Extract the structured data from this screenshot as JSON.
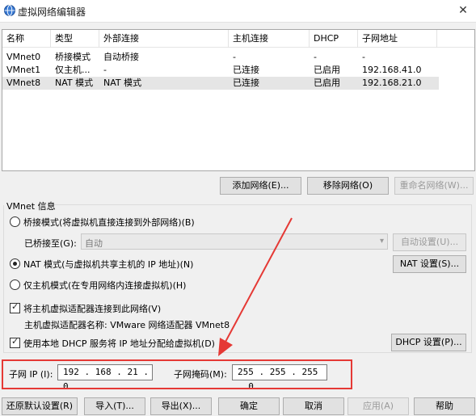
{
  "window": {
    "title": "虚拟网络编辑器",
    "close_glyph": "✕"
  },
  "table": {
    "headers": [
      "名称",
      "类型",
      "外部连接",
      "主机连接",
      "DHCP",
      "子网地址"
    ],
    "rows": [
      [
        "VMnet0",
        "桥接模式",
        "自动桥接",
        "-",
        "-",
        "-"
      ],
      [
        "VMnet1",
        "仅主机...",
        "-",
        "已连接",
        "已启用",
        "192.168.41.0"
      ],
      [
        "VMnet8",
        "NAT 模式",
        "NAT 模式",
        "已连接",
        "已启用",
        "192.168.21.0"
      ]
    ],
    "selected_row": 2
  },
  "net_buttons": {
    "add": "添加网络(E)...",
    "remove": "移除网络(O)",
    "rename": "重命名网络(W)..."
  },
  "vmnet_info": {
    "group_label": "VMnet 信息",
    "bridged_label": "桥接模式(将虚拟机直接连接到外部网络)(B)",
    "bridged_to_label": "已桥接至(G):",
    "bridged_to_value": "自动",
    "auto_settings": "自动设置(U)...",
    "nat_label": "NAT 模式(与虚拟机共享主机的 IP 地址)(N)",
    "nat_settings": "NAT 设置(S)...",
    "hostonly_label": "仅主机模式(在专用网络内连接虚拟机)(H)",
    "connect_host_adapter_label": "将主机虚拟适配器连接到此网络(V)",
    "adapter_name_label": "主机虚拟适配器名称: VMware 网络适配器 VMnet8",
    "dhcp_label": "使用本地 DHCP 服务将 IP 地址分配给虚拟机(D)",
    "dhcp_settings": "DHCP 设置(P)...",
    "selected_mode": "nat",
    "connect_host_adapter_checked": true,
    "dhcp_checked": true
  },
  "subnet": {
    "ip_label": "子网 IP (I):",
    "ip_value": "192 . 168 . 21 . 0",
    "mask_label": "子网掩码(M):",
    "mask_value": "255 . 255 . 255 . 0"
  },
  "bottom_buttons": {
    "restore": "还原默认设置(R)",
    "import": "导入(T)...",
    "export": "导出(X)...",
    "ok": "确定",
    "cancel": "取消",
    "apply": "应用(A)",
    "help": "帮助"
  },
  "colors": {
    "annotation": "#e53935",
    "selected_row": "#e5e5e5"
  },
  "icons": {
    "app": "network-globe-icon",
    "close": "close-icon",
    "check": "checkmark-icon",
    "dropdown": "chevron-down-icon"
  }
}
